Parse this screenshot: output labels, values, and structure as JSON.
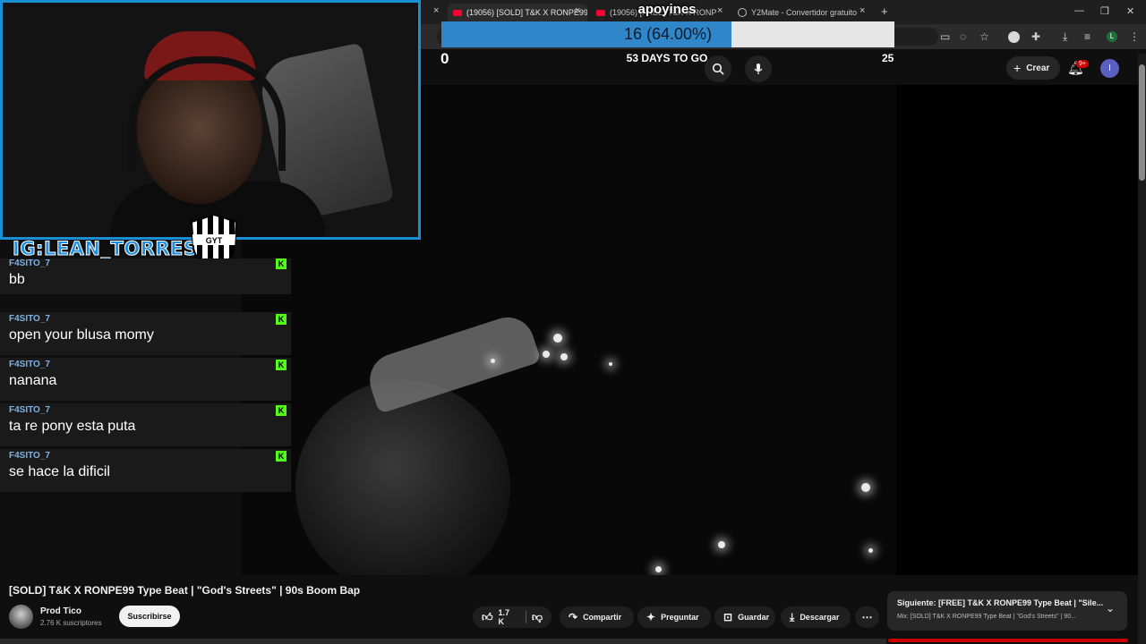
{
  "browser": {
    "tabs": [
      {
        "label": "(19056) [SOLD] T&K X RONPE99",
        "favicon": "youtube-icon",
        "active": true
      },
      {
        "label": "(19056) [FREE] T&K X RONPE99",
        "favicon": "youtube-icon",
        "active": false
      },
      {
        "label": "Y2Mate - Convertidor gratuito",
        "favicon": "globe-icon",
        "active": false
      }
    ],
    "new_tab": "+",
    "close": "×",
    "window_controls": {
      "minimize": "—",
      "restore": "❐",
      "close": "✕"
    },
    "profile_initial": "L"
  },
  "goal": {
    "title": "apoyines",
    "current": 16,
    "progress_text": "16 (64.00%)",
    "percent": 64.0,
    "start": "0",
    "end": "25",
    "days_left": "53 DAYS TO GO"
  },
  "youtube": {
    "create_label": "Crear",
    "notifications_badge": "9+",
    "avatar_initial": "I",
    "video_title": "[SOLD] T&K X RONPE99 Type Beat | \"God's Streets\" | 90s Boom Bap",
    "channel_name": "Prod Tico",
    "subscribers": "2.76 K suscriptores",
    "subscribe_label": "Suscribirse",
    "likes": "1.7 K",
    "share_label": "Compartir",
    "ask_label": "Preguntar",
    "save_label": "Guardar",
    "download_label": "Descargar",
    "up_next_title": "Siguiente: [FREE] T&K X RONPE99 Type Beat | \"Sile...",
    "up_next_subtitle": "Mix: [SOLD] T&K X RONPE99 Type Beat | \"God's Streets\" | 90..."
  },
  "stream": {
    "ig_tag": "IG:LEAN_TORRES14",
    "crest_text": "GYT"
  },
  "chat": [
    {
      "user": "F4SITO_7",
      "text": "bb"
    },
    {
      "user": "F4SITO_7",
      "text": "open your blusa momy"
    },
    {
      "user": "F4SITO_7",
      "text": "nanana"
    },
    {
      "user": "F4SITO_7",
      "text": "ta re pony esta puta"
    },
    {
      "user": "F4SITO_7",
      "text": "se hace la dificil"
    }
  ],
  "chat_badge": "K",
  "colors": {
    "goal_fill": "#2f86c9",
    "webcam_border": "#1a8fd6",
    "kick_green": "#53fc18",
    "youtube_red": "#ff0033"
  }
}
